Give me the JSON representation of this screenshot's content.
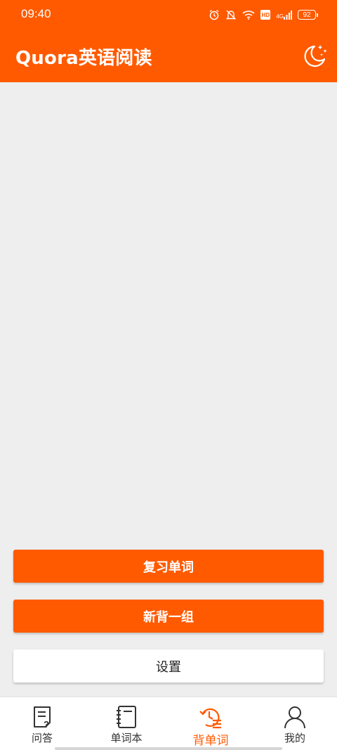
{
  "status_bar": {
    "time": "09:40",
    "battery": "92",
    "hd": "HD",
    "network": "4G",
    "icons": [
      "alarm-icon",
      "mute-icon",
      "wifi-icon",
      "hd-icon",
      "signal-icon",
      "battery-icon"
    ]
  },
  "header": {
    "title": "Quora英语阅读",
    "night_mode_icon": "moon-stars-icon",
    "background": "#ff5a00"
  },
  "actions": {
    "review_label": "复习单词",
    "new_group_label": "新背一组",
    "settings_label": "设置"
  },
  "bottom_nav": {
    "active_color": "#ff5a00",
    "items": [
      {
        "label": "问答",
        "icon": "qa-icon"
      },
      {
        "label": "单词本",
        "icon": "notebook-icon"
      },
      {
        "label": "背单词",
        "icon": "memorize-icon"
      },
      {
        "label": "我的",
        "icon": "profile-icon"
      }
    ],
    "active_index": 2
  }
}
